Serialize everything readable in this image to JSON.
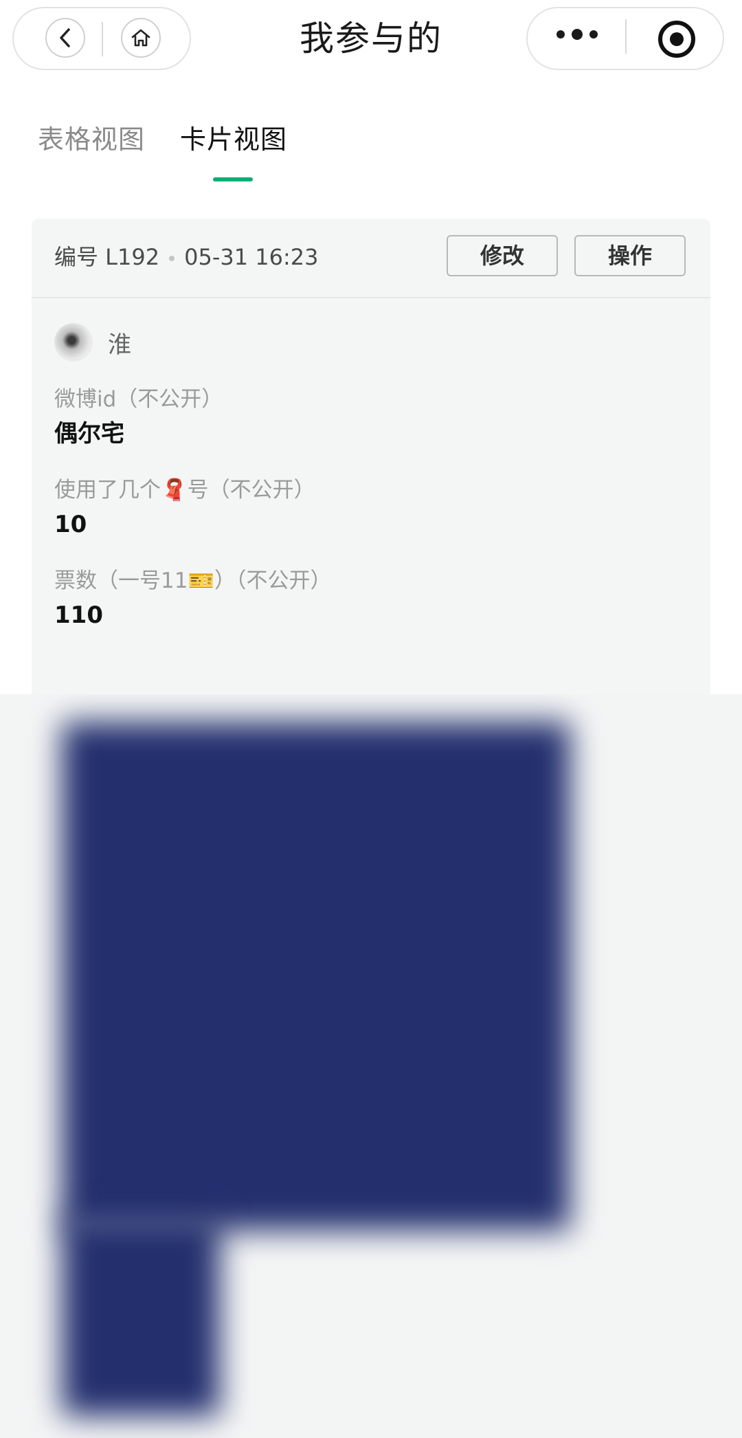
{
  "nav": {
    "title": "我参与的",
    "back_icon": "chevron-left-icon",
    "home_icon": "home-icon",
    "more_icon": "more-dots-icon",
    "target_icon": "target-icon"
  },
  "tabs": [
    {
      "label": "表格视图",
      "active": false
    },
    {
      "label": "卡片视图",
      "active": true
    }
  ],
  "accent_color": "#07b072",
  "card": {
    "serial": "编号 L192",
    "timestamp": "05-31 16:23",
    "edit_label": "修改",
    "action_label": "操作",
    "user": {
      "name": "淮"
    },
    "fields": [
      {
        "label": "微博id（不公开）",
        "value": "偶尔宅"
      },
      {
        "label": "使用了几个🧣号（不公开）",
        "value": "10"
      },
      {
        "label": "票数（一号11🎫）（不公开）",
        "value": "110"
      }
    ]
  }
}
